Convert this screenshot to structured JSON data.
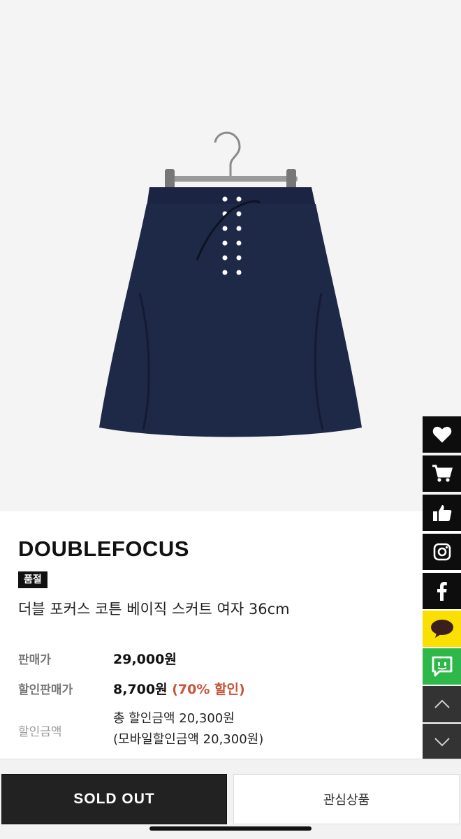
{
  "product": {
    "brand": "DOUBLEFOCUS",
    "badge": "품절",
    "name": "더블 포커스 코튼 베이직 스커트 여자 36cm"
  },
  "pricing": {
    "list_price_label": "판매가",
    "list_price": "29,000원",
    "sale_price_label": "할인판매가",
    "sale_price": "8,700원",
    "discount_note": "(70% 할인)",
    "discount_amount_label": "할인금액",
    "discount_total": "총 할인금액 20,300원",
    "discount_mobile": "(모바일할인금액 20,300원)"
  },
  "side_menu": {
    "items": [
      "heart-icon",
      "cart-icon",
      "thumbs-up-icon",
      "instagram-icon",
      "facebook-icon",
      "kakaotalk-icon",
      "talk-icon",
      "arrow-up-icon",
      "arrow-down-icon"
    ]
  },
  "actions": {
    "sold_out": "SOLD OUT",
    "wishlist": "관심상품"
  },
  "colors": {
    "discount": "#c8543a",
    "kakao": "#f9e000",
    "talk": "#2fb84a"
  }
}
